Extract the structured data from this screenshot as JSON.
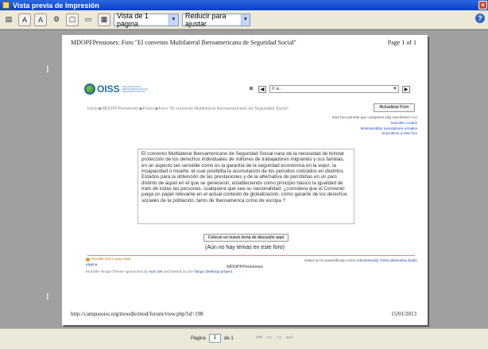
{
  "window": {
    "title": "Vista previa de Impresión",
    "close_label": "×"
  },
  "toolbar": {
    "view_mode": "Vista de 1 página",
    "zoom_mode": "Reducir para ajustar",
    "help_label": "?"
  },
  "page": {
    "header_left": "MDOPFPensiones: Foro \"El convenio Multilateral Iberoamericano de Seguridad Social\"",
    "header_right": "Page 1 of 1",
    "logo_text": "OISS",
    "logo_subtitle": "ORGANIZACIÓN IBEROAMERICANA DE SEGURIDAD SOCIAL",
    "nav_select": "Ir a...",
    "breadcrumb": "Inicio ▶MDOPFPensiones ▶Foros ▶Foro \"El convenio Multilateral Iberoamericano de Seguridad Social\"",
    "update_button": "Actualizar Foro",
    "subscribe_info": "Este foro permite que cualquiera elija suscribirse o no",
    "subscribe_link": "Suscribir a todos",
    "show_subscribers": "Mostrar/editar suscriptores actuales",
    "subscribe_forum": "Suscribirse a este foro",
    "description": "El convenio Multilateral Iberoamericano de Seguridad Social nace de la necesidad de brindar protección de los derechos individuales de millones de trabajadores migrantes y sus familias, en un aspecto tan sensible como es la garantía de la seguridad económica en la vejez, la incapacidad o muerte, el cual posibilita la acumulación de los periodos cotizados en distintos Estados para la obtención de las prestaciones y de la alternativa de percibirlas en un país distinto de aquel en el que se generaron, estableciendo como principio básico la igualdad de trato de todas las personas, cualquiera que sea su nacionalidad. ¿considera que el Convenio juega un papel relevante en el actual contexto de globalización, como garante de los derechos sociales de la población, tanto de Iberoamerica como de europa ?",
    "new_topic_button": "Colocar un nuevo tema de discusión aquí",
    "no_topics": "(Aún no hay temas en este foro)",
    "moodle_docs": "Moodle Docs para esta",
    "moodle_docs_page": "página",
    "user_info_prefix": "Usted se ha autentificado como ",
    "user_info_name": "Administrador OISS administra (Salir)",
    "site_name": "MDOPFPensiones",
    "theme_prefix": "MoOdle-Tango-Theme sponsored by ",
    "theme_link1": "eym.net",
    "theme_mid": " and based on the ",
    "theme_link2": "Tango Desktop project.",
    "footer_url": "http://campusoiss.org/moodle/mod/forum/view.php?id=198",
    "footer_date": "15/01/2013"
  },
  "statusbar": {
    "page_label": "Página",
    "page_value": "1",
    "of_label": "de 1"
  }
}
